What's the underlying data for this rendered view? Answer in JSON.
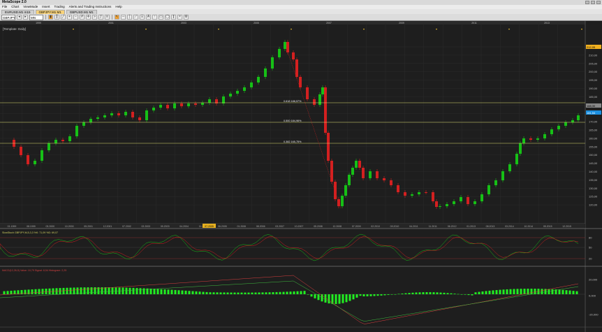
{
  "app": {
    "title": "MetaScope 2.0"
  },
  "menu": [
    "File",
    "Chart",
    "ViewMode",
    "Insert",
    "Trading",
    "Alerts and Trading Instructions",
    "Help"
  ],
  "tabs": [
    {
      "label": "EURUSD.M1 m15"
    },
    {
      "label": "GBPJPY.M1 M1",
      "active": true
    },
    {
      "label": "GBPUSD.M1 M1"
    }
  ],
  "toolbar": {
    "symbol": "GBPJPY",
    "period": "MN"
  },
  "template_label": "[Template: Daily]",
  "colors": {
    "bull": "#16c016",
    "bear": "#d42020",
    "fib": "#e0e070",
    "macd_hist": "#22ee22",
    "price_marker": "#1b8fe0",
    "fib_marker": "#f0b020"
  },
  "price_axis": {
    "ticks": [
      "215,00",
      "210,00",
      "205,00",
      "200,00",
      "195,00",
      "190,00",
      "185,00",
      "180,00",
      "175,00",
      "170,00",
      "165,00",
      "160,00",
      "155,00",
      "150,00",
      "145,00",
      "140,00",
      "135,00",
      "130,00",
      "125,00",
      "120,00"
    ],
    "current": "181,54",
    "line_label": "188,30",
    "top_marker": "212,95"
  },
  "fib_levels": [
    {
      "label": "0.618 188,57%"
    },
    {
      "label": "0.500 184,96%"
    },
    {
      "label": "0.382 165,75%"
    }
  ],
  "date_axis": [
    "01.1999",
    "08.1999",
    "03.2000",
    "10.2000",
    "05.2001",
    "12.2001",
    "07.2002",
    "02.2003",
    "09.2003",
    "04.2004",
    "11.2004",
    "06.2005",
    "01.2006",
    "08.2006",
    "03.2007",
    "10.2007",
    "05.2008",
    "12.2008",
    "07.2009",
    "02.2010",
    "09.2010",
    "04.2011",
    "11.2011",
    "06.2012",
    "01.2013",
    "08.2013",
    "03.2014",
    "10.2014",
    "05.2015",
    "12.2015"
  ],
  "date_highlight": "07.2005",
  "top_years": [
    "1999",
    "2001",
    "2003",
    "2005",
    "2007",
    "2009",
    "2011",
    "2013",
    "2015"
  ],
  "stoch": {
    "label": "SlowStoch GBPJPY,M,5,3,3 %K: 71,09 %D: 69,07",
    "ticks": [
      "80",
      "50",
      "20"
    ]
  },
  "macd": {
    "label": "MACD(12,26,9) Value: 10,79 Signal: 8,54 Histogram: 2,25",
    "ticks": [
      "20,000",
      "0,000",
      "-20,000"
    ]
  }
}
